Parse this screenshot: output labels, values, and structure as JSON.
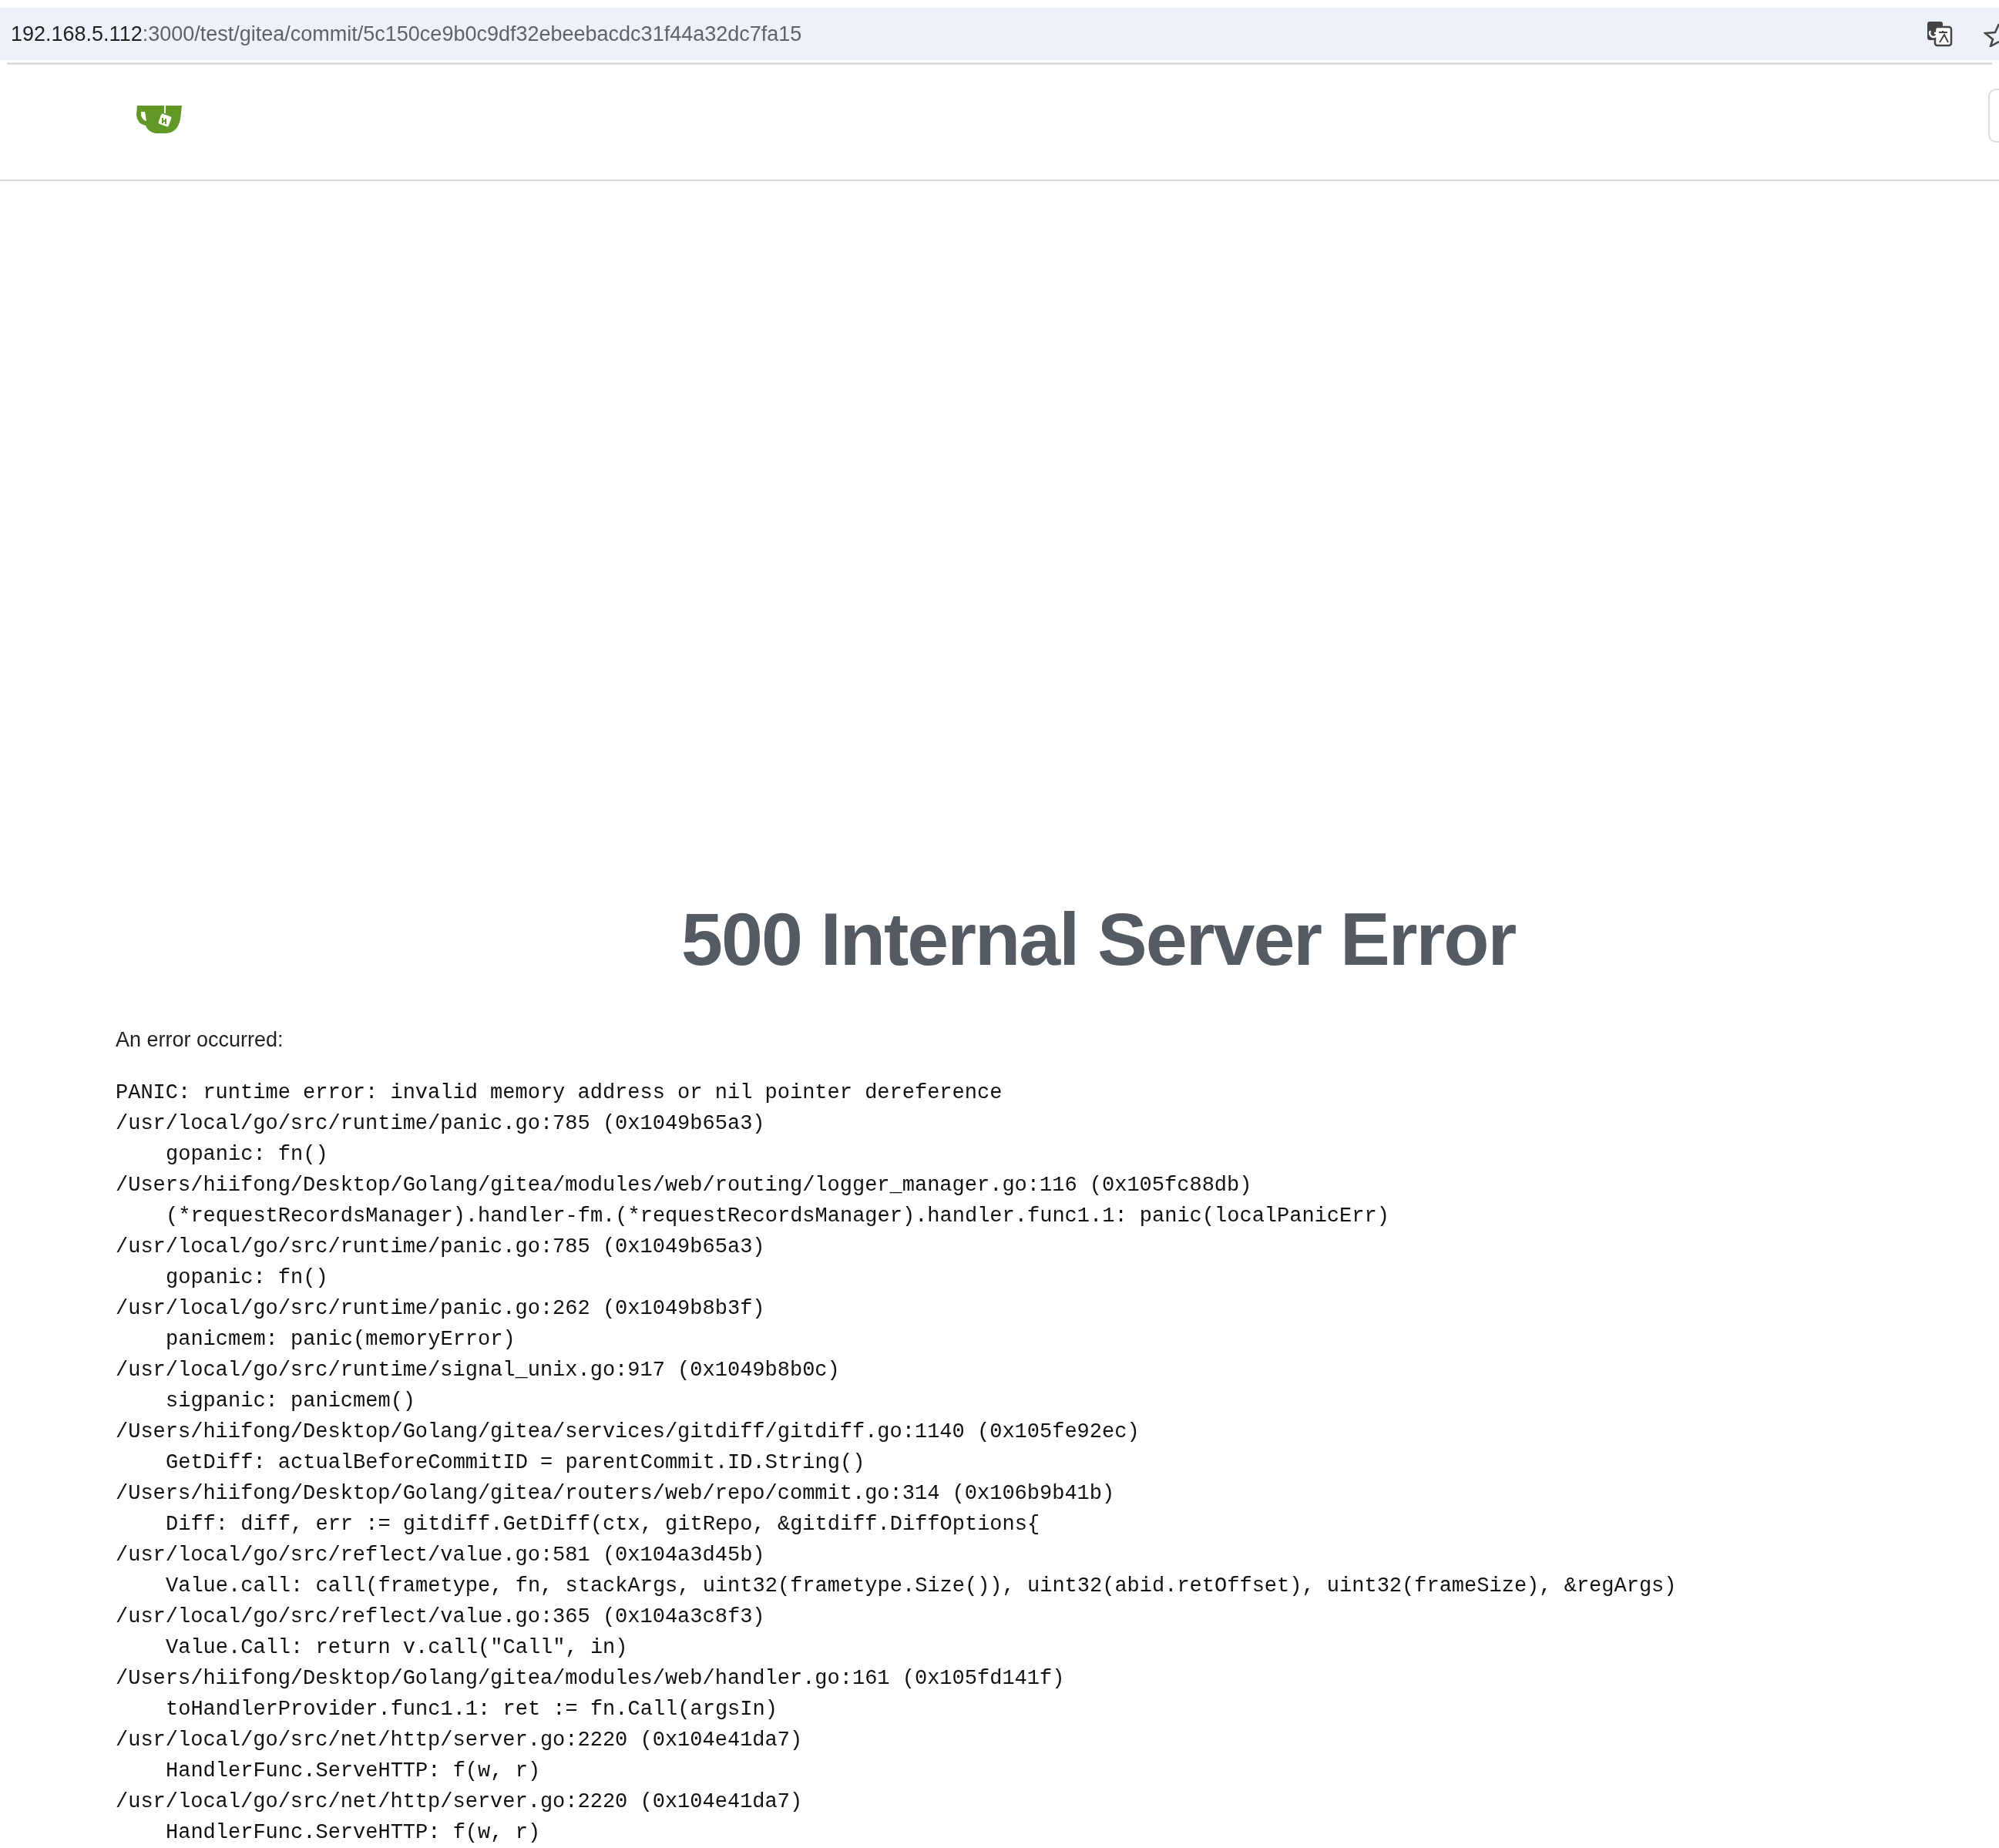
{
  "address_bar": {
    "host": "192.168.5.112",
    "path": ":3000/test/gitea/commit/5c150ce9b0c9df32ebeebacdc31f44a32dc7fa15"
  },
  "heading": "500 Internal Server Error",
  "intro": "An error occurred:",
  "trace": [
    {
      "kind": "message",
      "text": "PANIC: runtime error: invalid memory address or nil pointer dereference"
    },
    {
      "kind": "frame",
      "text": "/usr/local/go/src/runtime/panic.go:785 (0x1049b65a3)"
    },
    {
      "kind": "call",
      "text": "gopanic: fn()"
    },
    {
      "kind": "frame",
      "text": "/Users/hiifong/Desktop/Golang/gitea/modules/web/routing/logger_manager.go:116 (0x105fc88db)"
    },
    {
      "kind": "call",
      "text": "(*requestRecordsManager).handler-fm.(*requestRecordsManager).handler.func1.1: panic(localPanicErr)"
    },
    {
      "kind": "frame",
      "text": "/usr/local/go/src/runtime/panic.go:785 (0x1049b65a3)"
    },
    {
      "kind": "call",
      "text": "gopanic: fn()"
    },
    {
      "kind": "frame",
      "text": "/usr/local/go/src/runtime/panic.go:262 (0x1049b8b3f)"
    },
    {
      "kind": "call",
      "text": "panicmem: panic(memoryError)"
    },
    {
      "kind": "frame",
      "text": "/usr/local/go/src/runtime/signal_unix.go:917 (0x1049b8b0c)"
    },
    {
      "kind": "call",
      "text": "sigpanic: panicmem()"
    },
    {
      "kind": "frame",
      "text": "/Users/hiifong/Desktop/Golang/gitea/services/gitdiff/gitdiff.go:1140 (0x105fe92ec)"
    },
    {
      "kind": "call",
      "text": "GetDiff: actualBeforeCommitID = parentCommit.ID.String()"
    },
    {
      "kind": "frame",
      "text": "/Users/hiifong/Desktop/Golang/gitea/routers/web/repo/commit.go:314 (0x106b9b41b)"
    },
    {
      "kind": "call",
      "text": "Diff: diff, err := gitdiff.GetDiff(ctx, gitRepo, &gitdiff.DiffOptions{"
    },
    {
      "kind": "frame",
      "text": "/usr/local/go/src/reflect/value.go:581 (0x104a3d45b)"
    },
    {
      "kind": "call",
      "text": "Value.call: call(frametype, fn, stackArgs, uint32(frametype.Size()), uint32(abid.retOffset), uint32(frameSize), &regArgs)"
    },
    {
      "kind": "frame",
      "text": "/usr/local/go/src/reflect/value.go:365 (0x104a3c8f3)"
    },
    {
      "kind": "call",
      "text": "Value.Call: return v.call(\"Call\", in)"
    },
    {
      "kind": "frame",
      "text": "/Users/hiifong/Desktop/Golang/gitea/modules/web/handler.go:161 (0x105fd141f)"
    },
    {
      "kind": "call",
      "text": "toHandlerProvider.func1.1: ret := fn.Call(argsIn)"
    },
    {
      "kind": "frame",
      "text": "/usr/local/go/src/net/http/server.go:2220 (0x104e41da7)"
    },
    {
      "kind": "call",
      "text": "HandlerFunc.ServeHTTP: f(w, r)"
    },
    {
      "kind": "frame",
      "text": "/usr/local/go/src/net/http/server.go:2220 (0x104e41da7)"
    },
    {
      "kind": "call",
      "text": "HandlerFunc.ServeHTTP: f(w, r)"
    }
  ]
}
